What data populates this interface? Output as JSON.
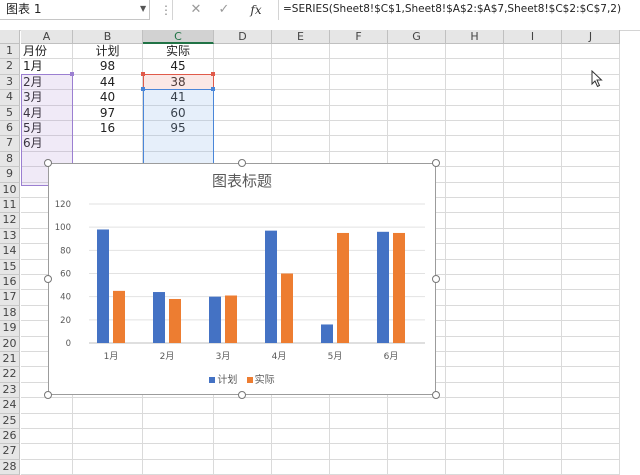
{
  "formula_bar": {
    "name_box": "图表 1",
    "formula": "=SERIES(Sheet8!$C$1,Sheet8!$A$2:$A$7,Sheet8!$C$2:$C$7,2)",
    "cancel_icon": "close-icon",
    "enter_icon": "check-icon",
    "fx_label": "fx"
  },
  "sheet": {
    "columns": [
      "A",
      "B",
      "C",
      "D",
      "E",
      "F",
      "G",
      "H",
      "I",
      "J"
    ],
    "rows": [
      "1",
      "2",
      "3",
      "4",
      "5",
      "6",
      "7",
      "8",
      "9",
      "10",
      "11",
      "12",
      "13",
      "14",
      "15",
      "16",
      "17",
      "18",
      "19",
      "20",
      "21",
      "22",
      "23",
      "24",
      "25",
      "26",
      "27",
      "28"
    ],
    "cells": {
      "A": [
        "月份",
        "1月",
        "2月",
        "3月",
        "4月",
        "5月",
        "6月"
      ],
      "B": [
        "计划",
        "98",
        "44",
        "40",
        "97",
        "16"
      ],
      "C": [
        "实际",
        "45",
        "38",
        "41",
        "60",
        "95"
      ]
    }
  },
  "chart_data": {
    "type": "bar",
    "title": "图表标题",
    "categories": [
      "1月",
      "2月",
      "3月",
      "4月",
      "5月",
      "6月"
    ],
    "series": [
      {
        "name": "计划",
        "values": [
          98,
          44,
          40,
          97,
          16,
          96
        ],
        "color": "#4472C4"
      },
      {
        "name": "实际",
        "values": [
          45,
          38,
          41,
          60,
          95,
          95
        ],
        "color": "#ED7D31"
      }
    ],
    "ylim": [
      0,
      120
    ],
    "yticks": [
      "0",
      "20",
      "40",
      "60",
      "80",
      "100",
      "120"
    ],
    "grid": true,
    "legend_position": "bottom"
  }
}
